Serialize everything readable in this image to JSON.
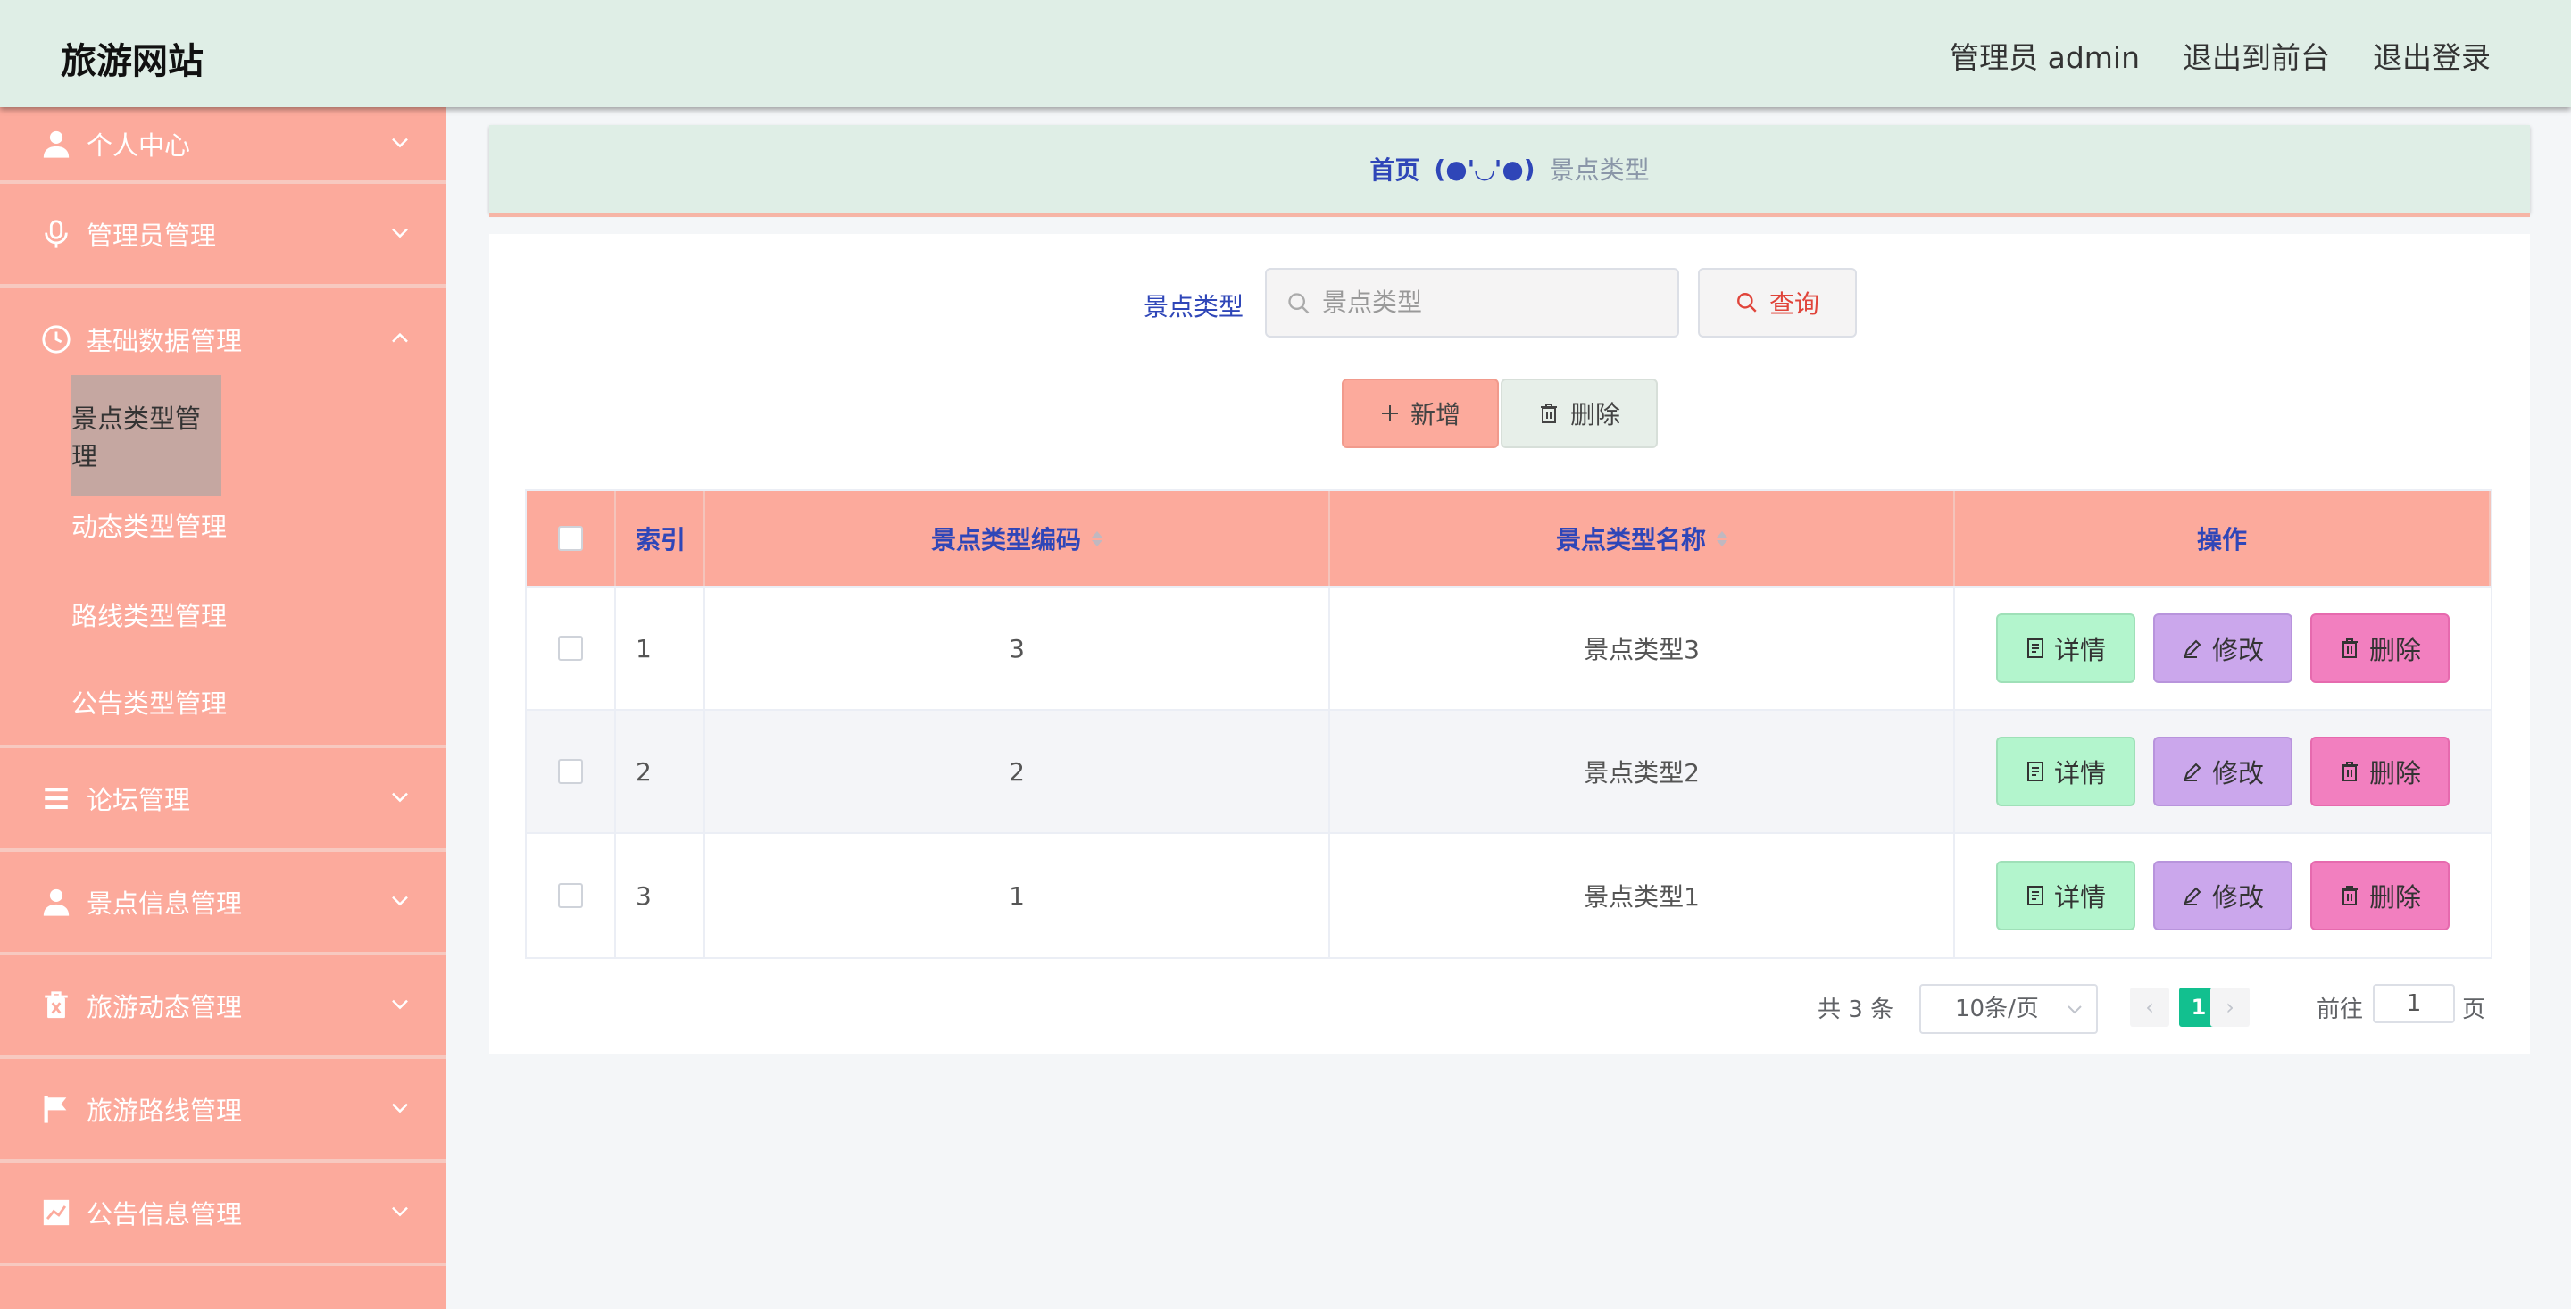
{
  "header": {
    "brand": "旅游网站",
    "admin_label": "管理员 admin",
    "back_to_front": "退出到前台",
    "logout": "退出登录"
  },
  "sidebar": {
    "items": [
      {
        "label": "个人中心",
        "icon": "user-icon"
      },
      {
        "label": "管理员管理",
        "icon": "mic-icon"
      },
      {
        "label": "基础数据管理",
        "icon": "clock-icon",
        "expanded": true,
        "children": [
          "景点类型管理",
          "动态类型管理",
          "路线类型管理",
          "公告类型管理"
        ]
      },
      {
        "label": "论坛管理",
        "icon": "list-icon"
      },
      {
        "label": "景点信息管理",
        "icon": "person-icon"
      },
      {
        "label": "旅游动态管理",
        "icon": "trash-icon"
      },
      {
        "label": "旅游路线管理",
        "icon": "flag-icon"
      },
      {
        "label": "公告信息管理",
        "icon": "chart-icon"
      }
    ],
    "active_child": "景点类型管理"
  },
  "breadcrumb": {
    "home": "首页",
    "separator": "(●'◡'●)",
    "current": "景点类型"
  },
  "search": {
    "label": "景点类型",
    "placeholder": "景点类型",
    "query_button": "查询"
  },
  "actions": {
    "add_button": "新增",
    "delete_button": "删除"
  },
  "table": {
    "columns": [
      "索引",
      "景点类型编码",
      "景点类型名称",
      "操作"
    ],
    "rows": [
      {
        "index": "1",
        "code": "3",
        "name": "景点类型3"
      },
      {
        "index": "2",
        "code": "2",
        "name": "景点类型2"
      },
      {
        "index": "3",
        "code": "1",
        "name": "景点类型1"
      }
    ],
    "row_actions": {
      "detail": "详情",
      "edit": "修改",
      "delete": "删除"
    }
  },
  "pagination": {
    "total": "共 3 条",
    "page_size": "10条/页",
    "current_page": "1",
    "goto_label": "前往",
    "goto_value": "1",
    "page_suffix": "页"
  },
  "colors": {
    "header_bg": "#dfeee6",
    "sidebar_bg": "#fcaa9c",
    "accent_blue": "#2f46b8",
    "pager_active": "#12c08f",
    "detail_btn": "#b3f5cd",
    "edit_btn": "#cba7ec",
    "delete_btn": "#f27fbf"
  }
}
